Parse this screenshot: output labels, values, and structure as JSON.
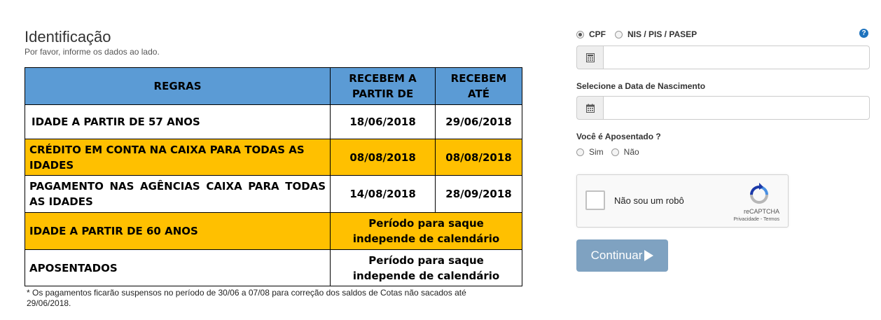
{
  "identification": {
    "title": "Identificação",
    "subtitle": "Por favor, informe os dados ao lado."
  },
  "rules_table": {
    "headers": [
      "REGRAS",
      "RECEBEM A PARTIR DE",
      "RECEBEM ATÉ"
    ],
    "rows": [
      {
        "rule": "IDADE A PARTIR DE 57 ANOS",
        "from": "18/06/2018",
        "until": "29/06/2018"
      },
      {
        "rule": "CRÉDITO EM CONTA NA CAIXA PARA TODAS AS IDADES",
        "from": "08/08/2018",
        "until": "08/08/2018"
      },
      {
        "rule": "PAGAMENTO NAS AGÊNCIAS CAIXA PARA TODAS AS IDADES",
        "from": "14/08/2018",
        "until": "28/09/2018"
      },
      {
        "rule": "IDADE A PARTIR DE 60 ANOS",
        "period": "Período para saque independe de calendário"
      },
      {
        "rule": "APOSENTADOS",
        "period": "Período para saque independe de calendário"
      }
    ],
    "colors": {
      "header": "#5b9bd5",
      "highlight": "#ffc000"
    }
  },
  "footnote": "* Os pagamentos ficarão suspensos no período de 30/06 a 07/08 para correção dos saldos de Cotas não sacados até 29/06/2018.",
  "form": {
    "doc_type_options": [
      "CPF",
      "NIS / PIS / PASEP"
    ],
    "doc_type_selected": "CPF",
    "help_icon": "?",
    "birthdate_label": "Selecione a Data de Nascimento",
    "retired_label": "Você é Aposentado ?",
    "retired_options": [
      "Sim",
      "Não"
    ]
  },
  "captcha": {
    "label": "Não sou um robô",
    "brand": "reCAPTCHA",
    "links": "Privacidade - Termos"
  },
  "continue_button": {
    "label": "Continuar",
    "color": "#7fa2c1"
  }
}
